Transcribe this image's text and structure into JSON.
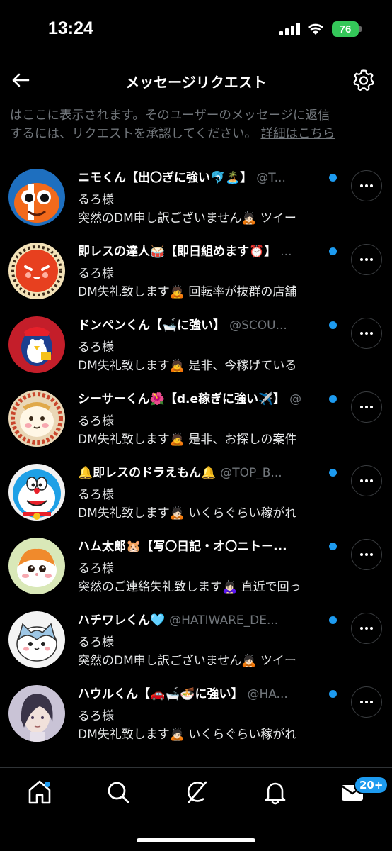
{
  "status_bar": {
    "time": "13:24",
    "battery": "76"
  },
  "header": {
    "title": "メッセージリクエスト"
  },
  "info": {
    "line1": "はここに表示されます。そのユーザーのメッセージに返信",
    "line2": "するには、リクエストを承認してください。",
    "link": "詳細はこちら"
  },
  "requests": [
    {
      "name": "ニモくん【出〇ぎに強い🐬🏝️】",
      "handle": "@T...",
      "line2": "るろ様",
      "line3": "突然のDM申し訳ございません🙇🏻 ツイー"
    },
    {
      "name": "即レスの達人🥁【即日組めます⏰】",
      "handle": "...",
      "line2": "るろ様",
      "line3": "DM失礼致します🙇 回転率が抜群の店舗"
    },
    {
      "name": "ドンペンくん【🛁に強い】",
      "handle": "@SCOU...",
      "line2": "るろ様",
      "line3": "DM失礼致します🙇 是非、今稼げている"
    },
    {
      "name": "シーサーくん🌺【d.e稼ぎに強い✈️】",
      "handle": "@",
      "line2": "るろ様",
      "line3": "DM失礼致します🙇 是非、お探しの案件"
    },
    {
      "name": "🔔即レスのドラえもん🔔",
      "handle": "@TOP_B...",
      "line2": "るろ様",
      "line3": "DM失礼致します🙇🏻 いくらぐらい稼がれ"
    },
    {
      "name": "ハム太郎🐹【写〇日記・オ〇ニトー...",
      "handle": "",
      "line2": "るろ様",
      "line3": "突然のご連絡失礼致します🙇🏻‍♀️ 直近で回っ"
    },
    {
      "name": "ハチワレくん🩵",
      "handle": "@HATIWARE_DE...",
      "line2": "るろ様",
      "line3": "突然のDM申し訳ございません🙇🏻 ツイー"
    },
    {
      "name": "ハウルくん【🚗🛁🍜に強い】",
      "handle": "@HA...",
      "line2": "るろ様",
      "line3": "DM失礼致します🙇🏻 いくらぐらい稼がれ"
    }
  ],
  "nav": {
    "badge": "20+"
  },
  "colors": {
    "accent": "#1d9bf0",
    "muted": "#71767b",
    "battery": "#34c759"
  }
}
